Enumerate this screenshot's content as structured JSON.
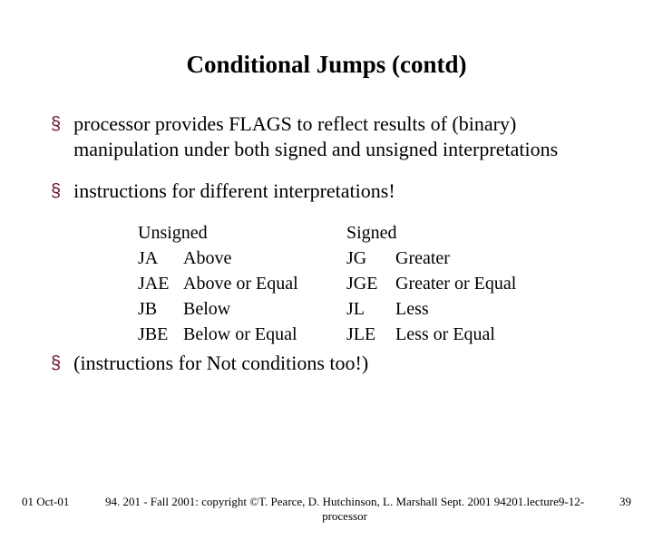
{
  "title": "Conditional Jumps (contd)",
  "bullets": {
    "b1": "processor provides FLAGS to reflect results of (binary) manipulation under both signed and unsigned interpretations",
    "b2": "instructions for different interpretations!",
    "b3": "(instructions for Not conditions too!)"
  },
  "table": {
    "unsigned": {
      "header": "Unsigned",
      "rows": [
        {
          "mn": "JA",
          "lb": "Above"
        },
        {
          "mn": "JAE",
          "lb": "Above or Equal"
        },
        {
          "mn": "JB",
          "lb": "Below"
        },
        {
          "mn": "JBE",
          "lb": "Below or Equal"
        }
      ]
    },
    "signed": {
      "header": "Signed",
      "rows": [
        {
          "mn": "JG",
          "lb": "Greater"
        },
        {
          "mn": "JGE",
          "lb": "Greater or Equal"
        },
        {
          "mn": "JL",
          "lb": "Less"
        },
        {
          "mn": "JLE",
          "lb": "Less or Equal"
        }
      ]
    }
  },
  "footer": {
    "date": "01 Oct-01",
    "center": "94. 201 - Fall 2001: copyright ©T. Pearce, D. Hutchinson, L. Marshall Sept. 2001 94201.lecture9-12-processor",
    "page": "39"
  },
  "glyphs": {
    "bullet": "§"
  }
}
